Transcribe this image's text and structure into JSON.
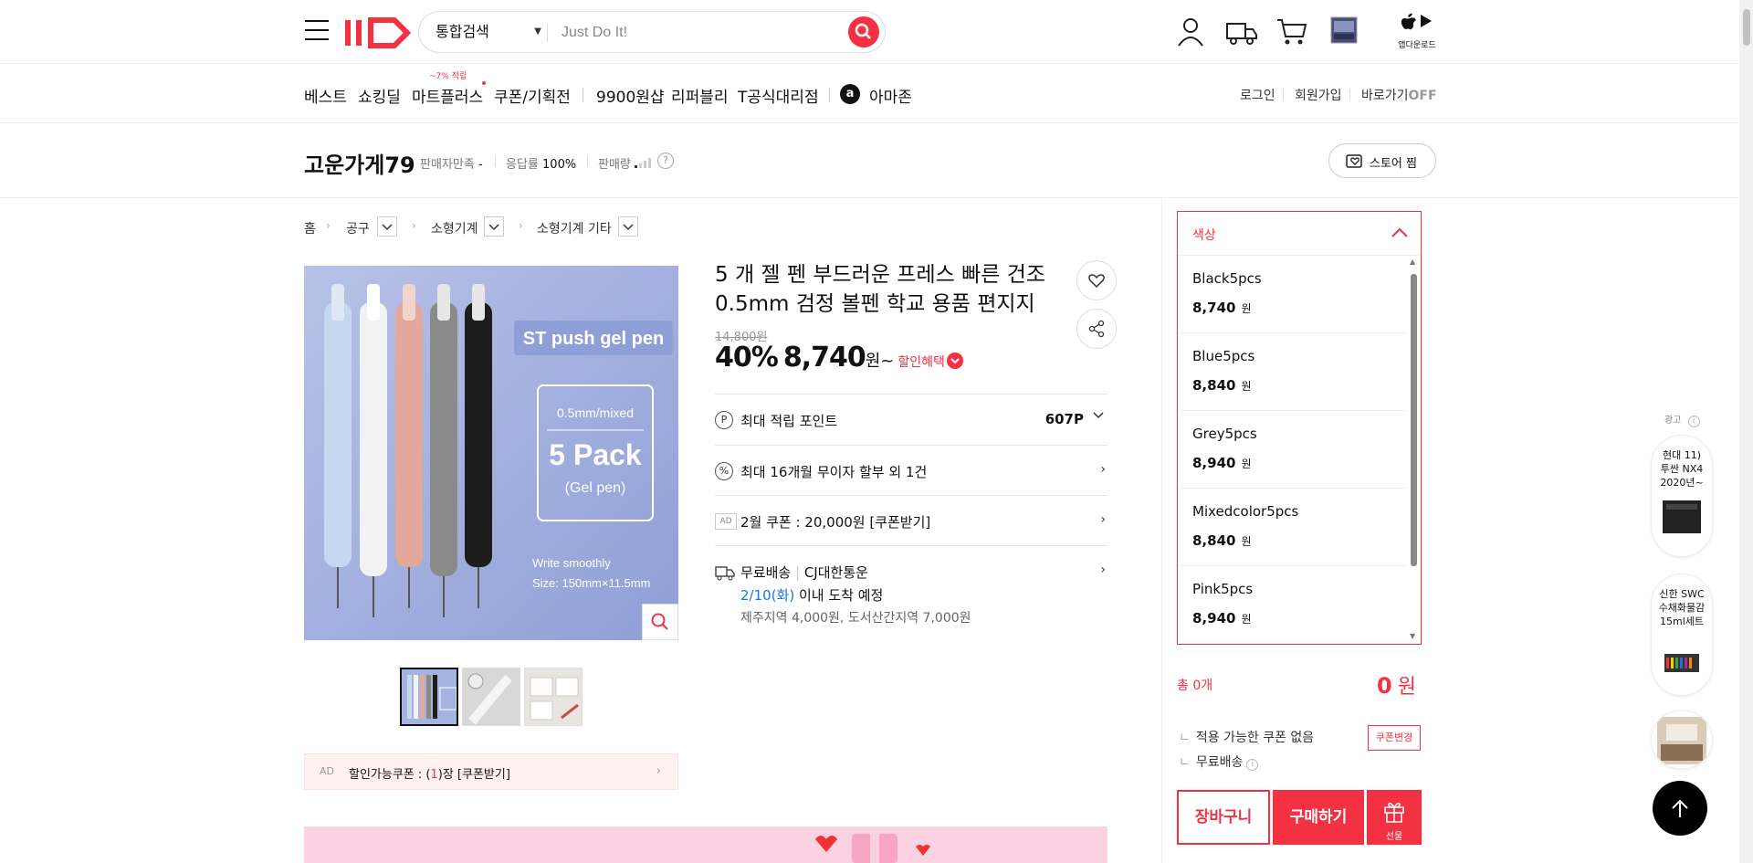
{
  "header": {
    "search_category": "통합검색",
    "search_placeholder": "Just Do It!",
    "app_download_label": "앱다운로드"
  },
  "nav": {
    "items": [
      "베스트",
      "쇼킹딜",
      "마트플러스",
      "쿠폰/기획전",
      "9900원샵",
      "리퍼블리",
      "T공식대리점",
      "아마존"
    ],
    "mart_badge": "~7% 적립",
    "utils": [
      "로그인",
      "회원가입",
      "바로가기"
    ],
    "shortcut_state": "OFF"
  },
  "store": {
    "name": "고운가게79",
    "satisfaction_label": "판매자만족",
    "satisfaction_value": "-",
    "response_label": "응답률",
    "response_value": "100%",
    "sales_label": "판매량",
    "favorite_label": "스토어 찜"
  },
  "breadcrumb": [
    "홈",
    "공구",
    "소형기계",
    "소형기계 기타"
  ],
  "product": {
    "title": "5 개 젤 펜 부드러운 프레스 빠른 건조 0.5mm 검정 볼펜 학교 용품 편지지",
    "original_price": "14,800원",
    "discount": "40%",
    "price": "8,740",
    "price_unit": "원~",
    "benefit_label": "할인혜택",
    "image_texts": {
      "brand": "ST push gel pen",
      "spec": "0.5mm/mixed",
      "pack": "5 Pack",
      "pack_sub": "(Gel pen)",
      "tagline": "Write smoothly",
      "size": "Size: 150mm×11.5mm"
    }
  },
  "info_rows": {
    "points_label": "최대 적립 포인트",
    "points_value": "607P",
    "installment_label": "최대 16개월 무이자 할부 외 1건",
    "coupon_ad": "AD",
    "coupon_label": "2월 쿠폰 : 20,000원 [쿠폰받기]",
    "shipping_label": "무료배송",
    "shipping_carrier": "CJ대한통운",
    "delivery_date": "2/10(화)",
    "delivery_suffix": "이내 도착 예정",
    "delivery_extra": "제주지역 4,000원, 도서산간지역 7,000원"
  },
  "coupon_bar": {
    "ad": "AD",
    "prefix": "할인가능쿠폰 : (",
    "count": "1",
    "suffix": ")장 [쿠폰받기]"
  },
  "options": {
    "header": "색상",
    "currency": "원",
    "items": [
      {
        "name": "Black5pcs",
        "price": "8,740"
      },
      {
        "name": "Blue5pcs",
        "price": "8,840"
      },
      {
        "name": "Grey5pcs",
        "price": "8,940"
      },
      {
        "name": "Mixedcolor5pcs",
        "price": "8,840"
      },
      {
        "name": "Pink5pcs",
        "price": "8,940"
      }
    ]
  },
  "summary": {
    "total_label": "총 0개",
    "total_amount": "0",
    "total_unit": "원",
    "no_coupon": "적용 가능한 쿠폰 없음",
    "coupon_change": "쿠폰변경",
    "free_shipping": "무료배송",
    "cart": "장바구니",
    "buy": "구매하기",
    "gift": "선물"
  },
  "ads": {
    "label": "광고",
    "card1": "현대 11)\n투싼 NX4\n2020년~",
    "card2": "신한 SWC\n수채화물감\n15ml세트"
  },
  "colors": {
    "accent": "#f43142",
    "image_bg": "#a4b3e0"
  }
}
